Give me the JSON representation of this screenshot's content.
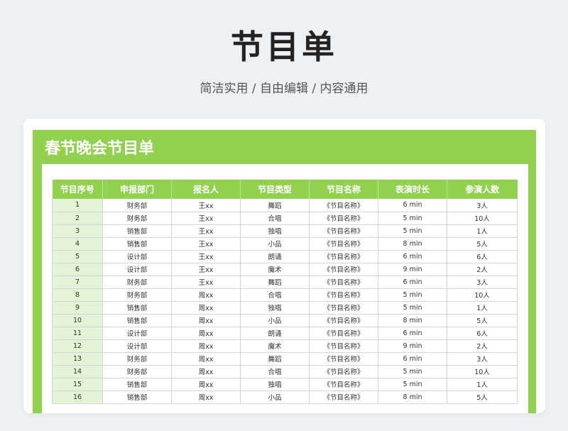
{
  "header": {
    "title": "节目单",
    "subtitle": "简洁实用 / 自由编辑 / 内容通用"
  },
  "sheet": {
    "title": "春节晚会节目单",
    "columns": [
      "节目序号",
      "申报部门",
      "报名人",
      "节目类型",
      "节目名称",
      "表演时长",
      "参演人数"
    ],
    "rows": [
      [
        "1",
        "财务部",
        "王xx",
        "舞蹈",
        "《节目名称》",
        "6 min",
        "3人"
      ],
      [
        "2",
        "财务部",
        "王xx",
        "合唱",
        "《节目名称》",
        "5 min",
        "10人"
      ],
      [
        "3",
        "销售部",
        "王xx",
        "独唱",
        "《节目名称》",
        "5 min",
        "1人"
      ],
      [
        "4",
        "销售部",
        "王xx",
        "小品",
        "《节目名称》",
        "8 min",
        "5人"
      ],
      [
        "5",
        "设计部",
        "王xx",
        "朗诵",
        "《节目名称》",
        "6 min",
        "6人"
      ],
      [
        "6",
        "设计部",
        "王xx",
        "魔术",
        "《节目名称》",
        "9 min",
        "2人"
      ],
      [
        "7",
        "财务部",
        "王xx",
        "舞蹈",
        "《节目名称》",
        "6 min",
        "3人"
      ],
      [
        "8",
        "财务部",
        "周xx",
        "合唱",
        "《节目名称》",
        "5 min",
        "10人"
      ],
      [
        "9",
        "销售部",
        "周xx",
        "独唱",
        "《节目名称》",
        "5 min",
        "1人"
      ],
      [
        "10",
        "销售部",
        "周xx",
        "小品",
        "《节目名称》",
        "8 min",
        "5人"
      ],
      [
        "11",
        "设计部",
        "周xx",
        "朗诵",
        "《节目名称》",
        "6 min",
        "6人"
      ],
      [
        "12",
        "设计部",
        "周xx",
        "魔术",
        "《节目名称》",
        "9 min",
        "2人"
      ],
      [
        "13",
        "财务部",
        "周xx",
        "舞蹈",
        "《节目名称》",
        "6 min",
        "3人"
      ],
      [
        "14",
        "财务部",
        "周xx",
        "合唱",
        "《节目名称》",
        "5 min",
        "10人"
      ],
      [
        "15",
        "销售部",
        "周xx",
        "独唱",
        "《节目名称》",
        "5 min",
        "1人"
      ],
      [
        "16",
        "销售部",
        "周xx",
        "小品",
        "《节目名称》",
        "8 min",
        "5人"
      ]
    ]
  },
  "colors": {
    "accent": "#92d050",
    "index_cell": "#e4f2d6",
    "background": "#eef1f3"
  }
}
